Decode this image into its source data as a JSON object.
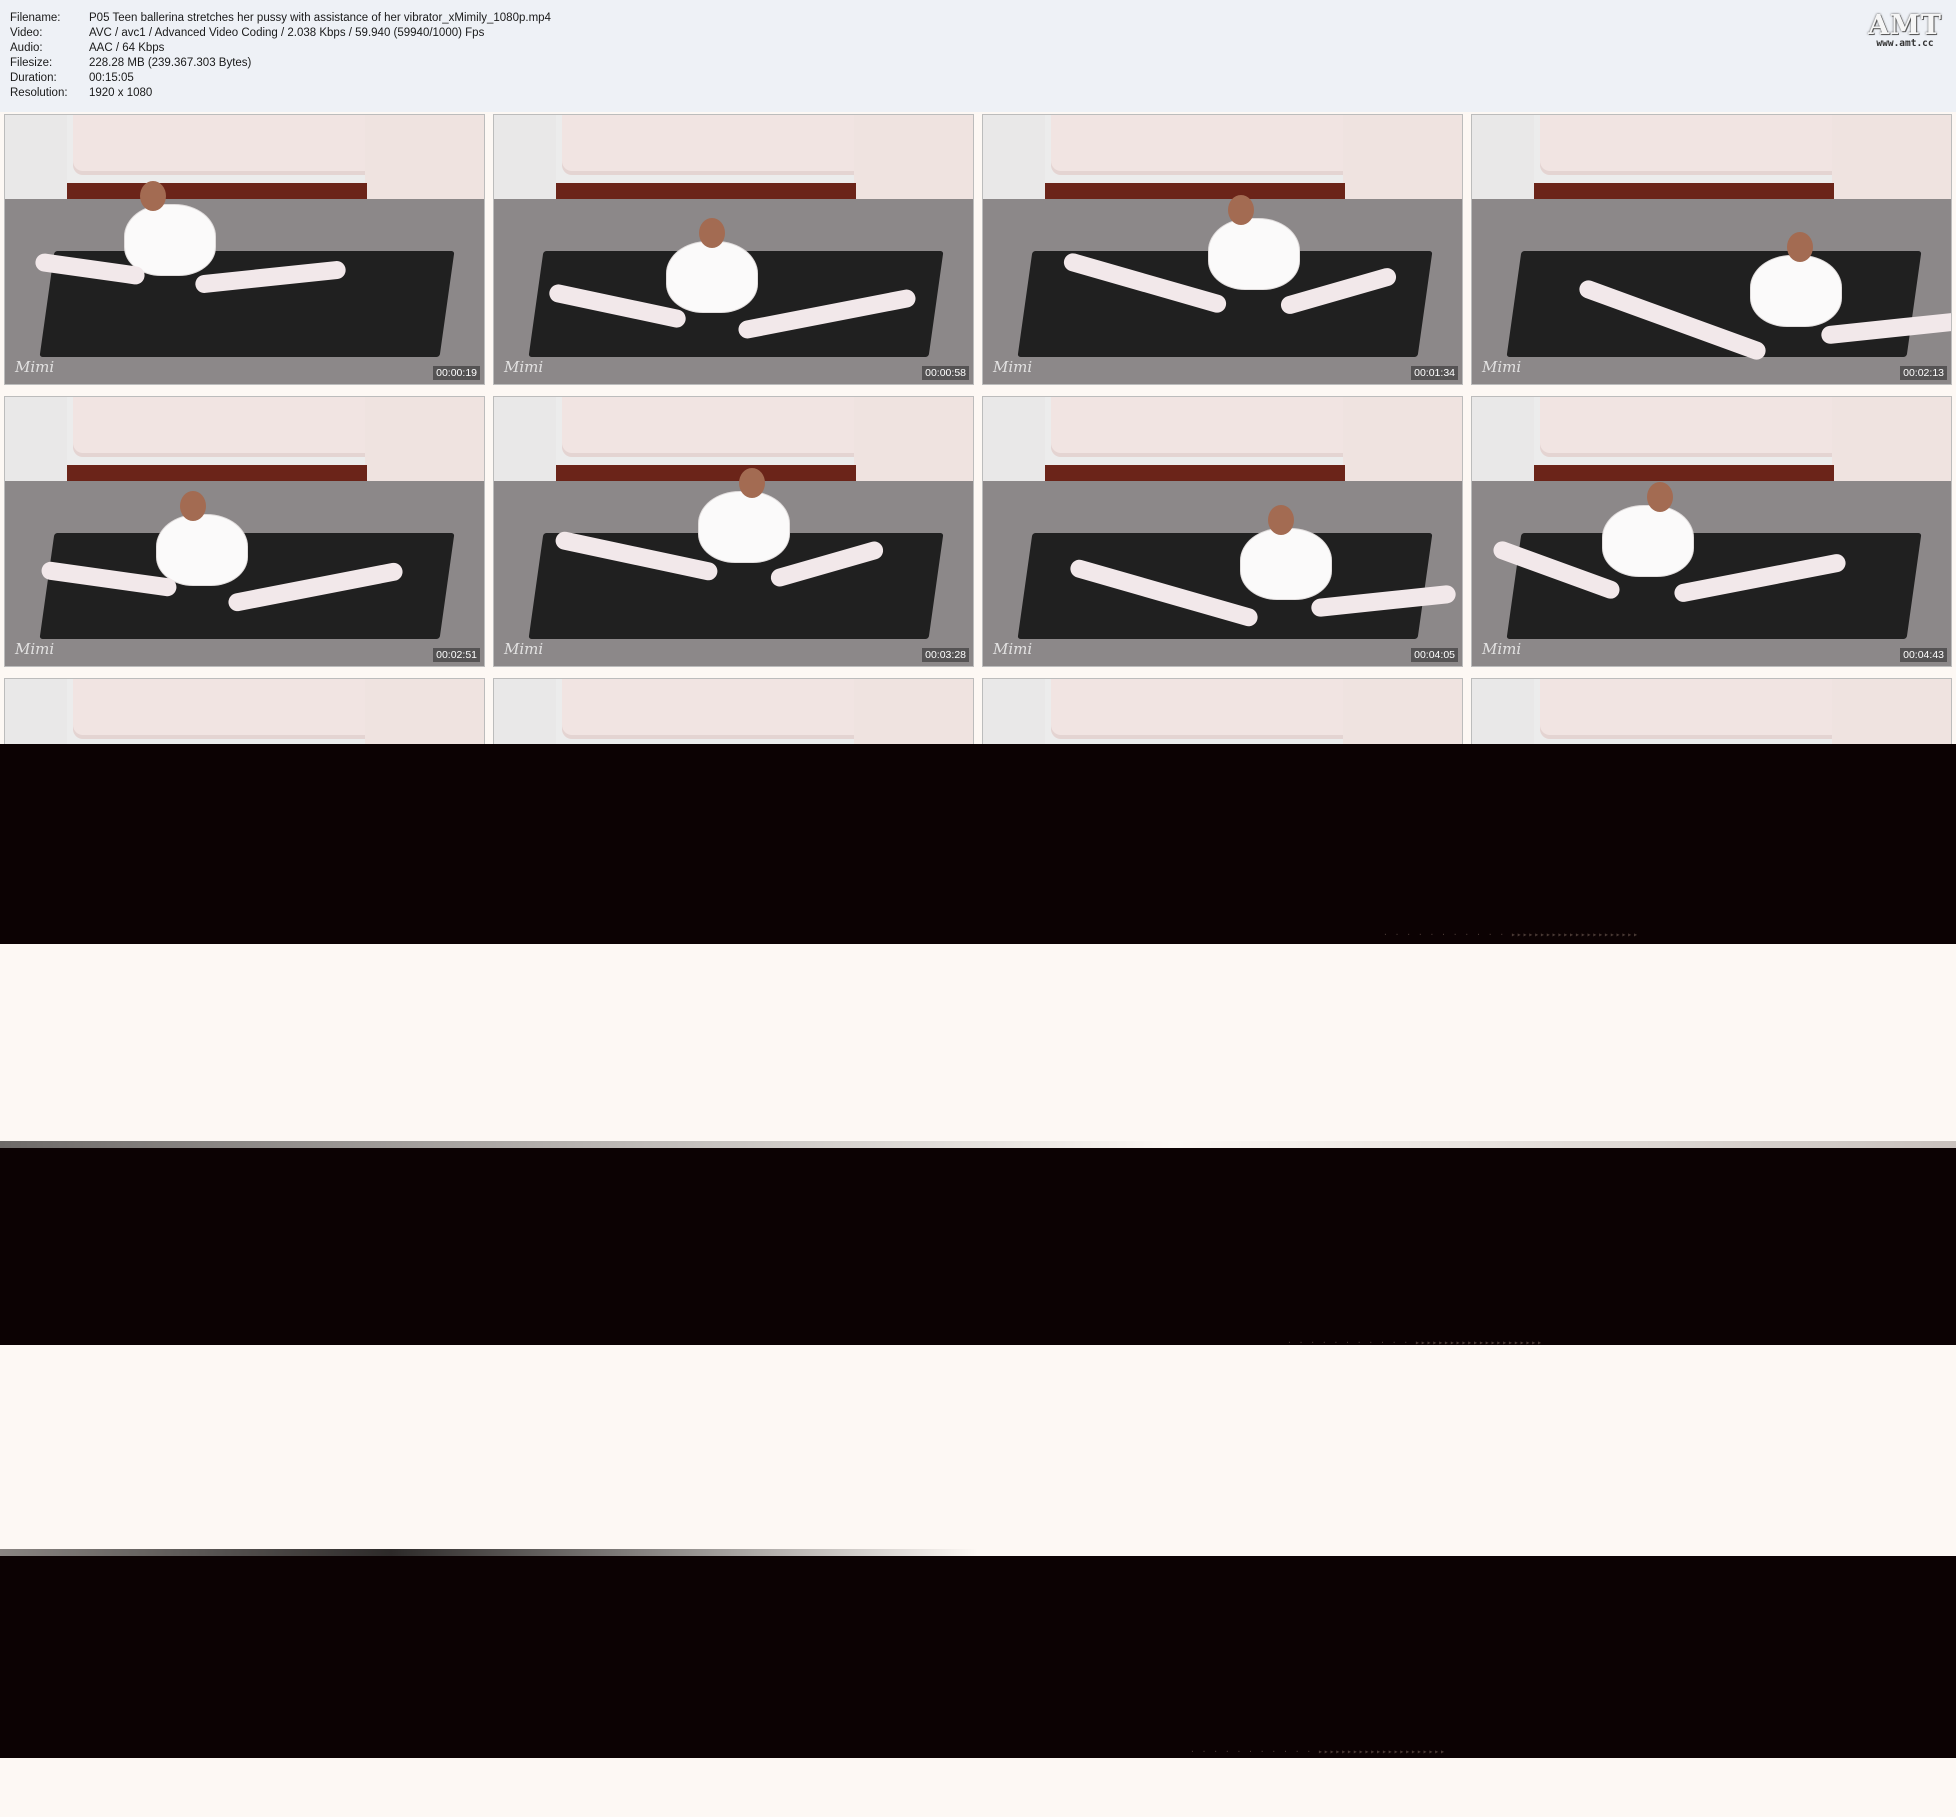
{
  "header": {
    "fields": [
      {
        "key": "Filename:",
        "value": "P05 Teen ballerina stretches her pussy with assistance of her vibrator_xMimily_1080p.mp4"
      },
      {
        "key": "Video:",
        "value": "AVC / avc1 / Advanced Video Coding / 2.038 Kbps / 59.940 (59940/1000) Fps"
      },
      {
        "key": "Audio:",
        "value": "AAC / 64 Kbps"
      },
      {
        "key": "Filesize:",
        "value": "228.28 MB (239.367.303 Bytes)"
      },
      {
        "key": "Duration:",
        "value": "00:15:05"
      },
      {
        "key": "Resolution:",
        "value": "1920 x 1080"
      }
    ],
    "logo": {
      "mark": "AMT",
      "url": "www.amt.cc"
    }
  },
  "thumbnails": [
    {
      "timestamp": "00:00:19",
      "watermark": "Mimi"
    },
    {
      "timestamp": "00:00:58",
      "watermark": "Mimi"
    },
    {
      "timestamp": "00:01:34",
      "watermark": "Mimi"
    },
    {
      "timestamp": "00:02:13",
      "watermark": "Mimi"
    },
    {
      "timestamp": "00:02:51",
      "watermark": "Mimi"
    },
    {
      "timestamp": "00:03:28",
      "watermark": "Mimi"
    },
    {
      "timestamp": "00:04:05",
      "watermark": "Mimi"
    },
    {
      "timestamp": "00:04:43",
      "watermark": "Mimi"
    },
    {
      "timestamp": "",
      "watermark": ""
    },
    {
      "timestamp": "",
      "watermark": ""
    },
    {
      "timestamp": "",
      "watermark": ""
    },
    {
      "timestamp": "",
      "watermark": ""
    }
  ],
  "colors": {
    "header_bg": "#eef1f6",
    "dark_band": "#0c0203",
    "light_band": "#fdf8f4"
  }
}
